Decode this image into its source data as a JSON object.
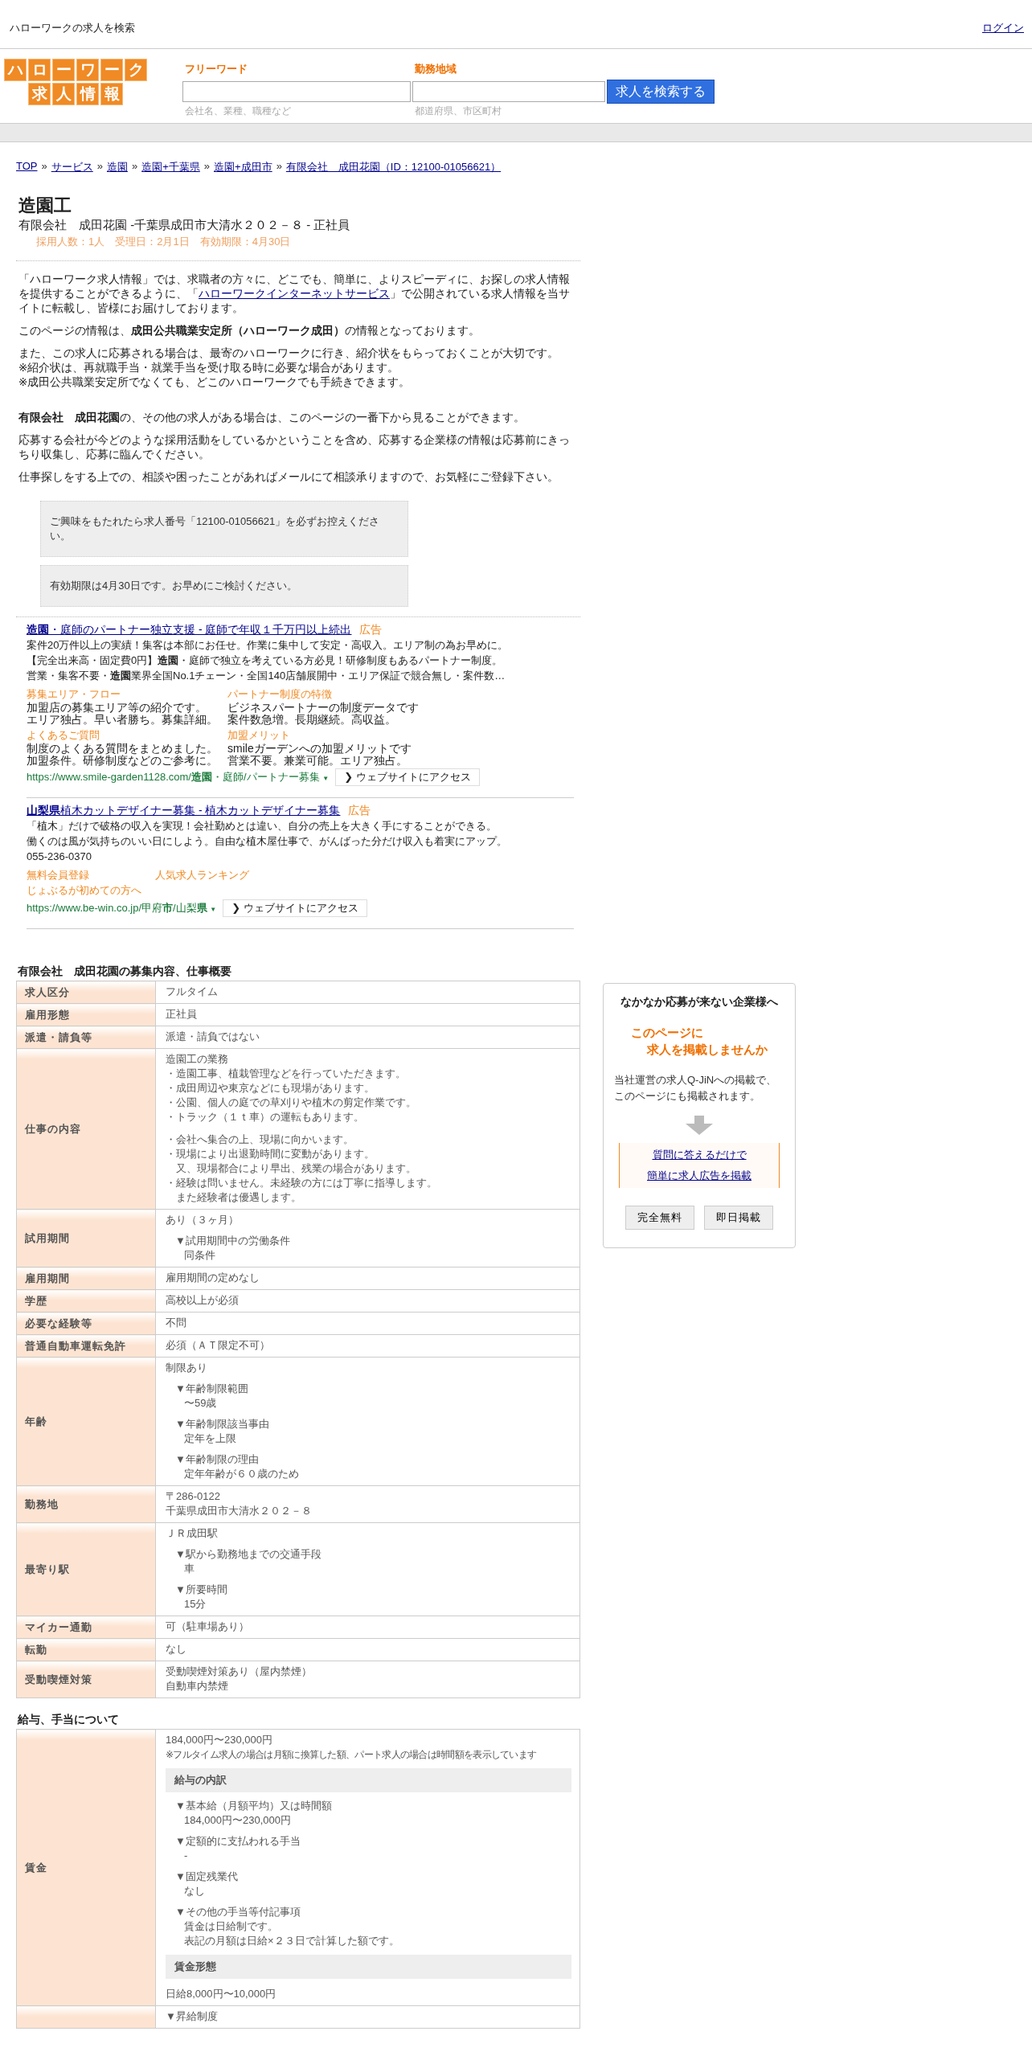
{
  "header": {
    "site_title": "ハローワークの求人を検索",
    "login": "ログイン"
  },
  "logo": {
    "top": "ハローワーク",
    "bottom": "求人情報"
  },
  "search": {
    "fields": [
      {
        "label": "フリーワード",
        "hint": "会社名、業種、職種など"
      },
      {
        "label": "勤務地域",
        "hint": "都道府県、市区町村"
      }
    ],
    "button": "求人を検索する"
  },
  "breadcrumb": {
    "separator": "»",
    "items": [
      "TOP",
      "サービス",
      "造園",
      "造園+千葉県",
      "造園+成田市",
      "有限会社　成田花園（ID：12100-01056621）"
    ]
  },
  "job": {
    "title": "造園工",
    "subtitle": "有限会社　成田花園 -千葉県成田市大清水２０２－８ - 正社員",
    "meta": "採用人数：1人　受理日：2月1日　有効期限：4月30日"
  },
  "intro": [
    {
      "kind": "link",
      "before": "「ハローワーク求人情報」では、求職者の方々に、どこでも、簡単に、よりスピーディに、お探しの求人情報を提供することができるように、「",
      "link": "ハローワークインターネットサービス",
      "after": "」で公開されている求人情報を当サイトに転載し、皆様にお届けしております。"
    },
    {
      "kind": "text",
      "text": "このページの情報は、**成田公共職業安定所（ハローワーク成田）**の情報となっております。"
    },
    {
      "kind": "text",
      "text": "また、この求人に応募される場合は、最寄のハローワークに行き、紹介状をもらっておくことが大切です。\n※紹介状は、再就職手当・就業手当を受け取る時に必要な場合があります。\n※成田公共職業安定所でなくても、どこのハローワークでも手続きできます。"
    },
    {
      "kind": "spaced",
      "text": "**有限会社　成田花園**の、その他の求人がある場合は、このページの一番下から見ることができます。"
    },
    {
      "kind": "text",
      "text": "応募する会社が今どのような採用活動をしているかということを含め、応募する企業様の情報は応募前にきっちり収集し、応募に臨んでください。"
    },
    {
      "kind": "text",
      "text": "仕事探しをする上での、相談や困ったことがあればメールにて相談承りますので、お気軽にご登録下さい。"
    }
  ],
  "notices": [
    "ご興味をもたれたら求人番号「12100-01056621」を必ずお控えください。",
    "有効期限は4月30日です。お早めにご検討ください。"
  ],
  "ads": [
    {
      "title": "**造園**・庭師のパートナー独立支援 - 庭師で年収１千万円以上続出",
      "badge": "広告",
      "description": [
        "案件20万件以上の実績！集客は本部にお任せ。作業に集中して安定・高収入。エリア制の為お早めに。",
        "【完全出来高・固定費0円】**造園**・庭師で独立を考えている方必見！研修制度もあるパートナー制度。",
        "営業・集客不要・**造園**業界全国No.1チェーン・全国140店舗展開中・エリア保証で競合無し・案件数…"
      ],
      "sitelinks": [
        {
          "title": "募集エリア・フロー",
          "lines": [
            "加盟店の募集エリア等の紹介です。",
            "エリア独占。早い者勝ち。募集詳細。"
          ]
        },
        {
          "title": "パートナー制度の特徴",
          "lines": [
            "ビジネスパートナーの制度データです",
            "案件数急増。長期継続。高収益。"
          ]
        },
        {
          "title": "よくあるご質問",
          "lines": [
            "制度のよくある質問をまとめました。",
            "加盟条件。研修制度などのご参考に。"
          ]
        },
        {
          "title": "加盟メリット",
          "lines": [
            "smileガーデンへの加盟メリットです",
            "営業不要。兼業可能。エリア独占。"
          ]
        }
      ],
      "url": "https://www.smile-garden1128.com/**造園**・庭師/パートナー募集",
      "url_caret": "▼",
      "button": "❯ ウェブサイトにアクセス"
    },
    {
      "title": "**山梨県**植木カットデザイナー募集 - 植木カットデザイナー募集",
      "badge": "広告",
      "description": [
        "「植木」だけで破格の収入を実現！会社勤めとは違い、自分の売上を大きく手にすることができる。",
        "働くのは風が気持ちのいい日にしよう。自由な植木屋仕事で、がんばった分だけ収入も着実にアップ。"
      ],
      "phone": "055-236-0370",
      "links": [
        "無料会員登録",
        "人気求人ランキング",
        "じょぶるが初めての方へ"
      ],
      "url": "https://www.be-win.co.jp/甲府**市**/山梨**県**",
      "url_caret": "▼",
      "button": "❯ ウェブサイトにアクセス"
    }
  ],
  "overview": {
    "heading": "有限会社　成田花園の募集内容、仕事概要",
    "rows": [
      {
        "label": "求人区分",
        "blocks": [
          {
            "kind": "text",
            "lines": [
              "フルタイム"
            ]
          }
        ]
      },
      {
        "label": "雇用形態",
        "blocks": [
          {
            "kind": "text",
            "lines": [
              "正社員"
            ]
          }
        ]
      },
      {
        "label": "派遣・請負等",
        "blocks": [
          {
            "kind": "text",
            "lines": [
              "派遣・請負ではない"
            ]
          }
        ]
      },
      {
        "label": "仕事の内容",
        "blocks": [
          {
            "kind": "text",
            "lines": [
              "造園工の業務",
              "・造園工事、植栽管理などを行っていただきます。",
              "・成田周辺や東京などにも現場があります。",
              "・公園、個人の庭での草刈りや植木の剪定作業です。",
              "・トラック（１ｔ車）の運転もあります。"
            ]
          },
          {
            "kind": "text",
            "lines": [
              "・会社へ集合の上、現場に向かいます。",
              "・現場により出退勤時間に変動があります。",
              "　又、現場都合により早出、残業の場合があります。",
              "・経験は問いません。未経験の方には丁寧に指導します。",
              "　また経験者は優遇します。"
            ]
          }
        ]
      },
      {
        "label": "試用期間",
        "blocks": [
          {
            "kind": "text",
            "lines": [
              "あり（３ヶ月）"
            ]
          },
          {
            "kind": "note",
            "heading": "▼試用期間中の労働条件",
            "lines": [
              "同条件"
            ]
          }
        ]
      },
      {
        "label": "雇用期間",
        "blocks": [
          {
            "kind": "text",
            "lines": [
              "雇用期間の定めなし"
            ]
          }
        ]
      },
      {
        "label": "学歴",
        "blocks": [
          {
            "kind": "text",
            "lines": [
              "高校以上が必須"
            ]
          }
        ]
      },
      {
        "label": "必要な経験等",
        "blocks": [
          {
            "kind": "text",
            "lines": [
              "不問"
            ]
          }
        ]
      },
      {
        "label": "普通自動車運転免許",
        "blocks": [
          {
            "kind": "text",
            "lines": [
              "必須（ＡＴ限定不可）"
            ]
          }
        ]
      },
      {
        "label": "年齢",
        "blocks": [
          {
            "kind": "text",
            "lines": [
              "制限あり"
            ]
          },
          {
            "kind": "note",
            "heading": "▼年齢制限範囲",
            "lines": [
              "〜59歳"
            ]
          },
          {
            "kind": "note",
            "heading": "▼年齢制限該当事由",
            "lines": [
              "定年を上限"
            ]
          },
          {
            "kind": "note",
            "heading": "▼年齢制限の理由",
            "lines": [
              "定年年齢が６０歳のため"
            ]
          }
        ]
      },
      {
        "label": "勤務地",
        "blocks": [
          {
            "kind": "text",
            "lines": [
              "〒286-0122",
              "千葉県成田市大清水２０２－８"
            ]
          }
        ]
      },
      {
        "label": "最寄り駅",
        "blocks": [
          {
            "kind": "text",
            "lines": [
              "ＪＲ成田駅"
            ]
          },
          {
            "kind": "note",
            "heading": "▼駅から勤務地までの交通手段",
            "lines": [
              "車"
            ]
          },
          {
            "kind": "note",
            "heading": "▼所要時間",
            "lines": [
              "15分"
            ]
          }
        ]
      },
      {
        "label": "マイカー通勤",
        "blocks": [
          {
            "kind": "text",
            "lines": [
              "可（駐車場あり）"
            ]
          }
        ]
      },
      {
        "label": "転勤",
        "blocks": [
          {
            "kind": "text",
            "lines": [
              "なし"
            ]
          }
        ]
      },
      {
        "label": "受動喫煙対策",
        "blocks": [
          {
            "kind": "text",
            "lines": [
              "受動喫煙対策あり（屋内禁煙）",
              "自動車内禁煙"
            ]
          }
        ]
      }
    ]
  },
  "salary": {
    "heading": "給与、手当について",
    "rows": [
      {
        "label": "賃金",
        "blocks": [
          {
            "kind": "text",
            "lines": [
              "184,000円〜230,000円"
            ]
          },
          {
            "kind": "small",
            "lines": [
              "※フルタイム求人の場合は月額に換算した額、パート求人の場合は時間額を表示しています"
            ]
          },
          {
            "kind": "bar",
            "text": "給与の内訳"
          },
          {
            "kind": "note",
            "heading": "▼基本給（月額平均）又は時間額",
            "lines": [
              "184,000円〜230,000円"
            ]
          },
          {
            "kind": "note",
            "heading": "▼定額的に支払われる手当",
            "lines": [
              "-"
            ]
          },
          {
            "kind": "note",
            "heading": "▼固定残業代",
            "lines": [
              "なし"
            ]
          },
          {
            "kind": "note",
            "heading": "▼その他の手当等付記事項",
            "lines": [
              "賃金は日給制です。",
              "表記の月額は日給×２３日で計算した額です。"
            ]
          },
          {
            "kind": "bar",
            "text": "賃金形態"
          },
          {
            "kind": "text",
            "lines": [
              "日給8,000円〜10,000円"
            ]
          }
        ]
      },
      {
        "blocks": [
          {
            "kind": "text",
            "lines": [
              "▼昇給制度"
            ]
          }
        ]
      }
    ]
  },
  "sidebar": {
    "title": "なかなか応募が来ない企業様へ",
    "catch": [
      "このページに",
      "求人を掲載しませんか"
    ],
    "text": "当社運営の求人Q-JiNへの掲載で、このページにも掲載されます。",
    "links": [
      "質問に答えるだけで",
      "簡単に求人広告を掲載"
    ],
    "buttons": [
      "完全無料",
      "即日掲載"
    ]
  }
}
